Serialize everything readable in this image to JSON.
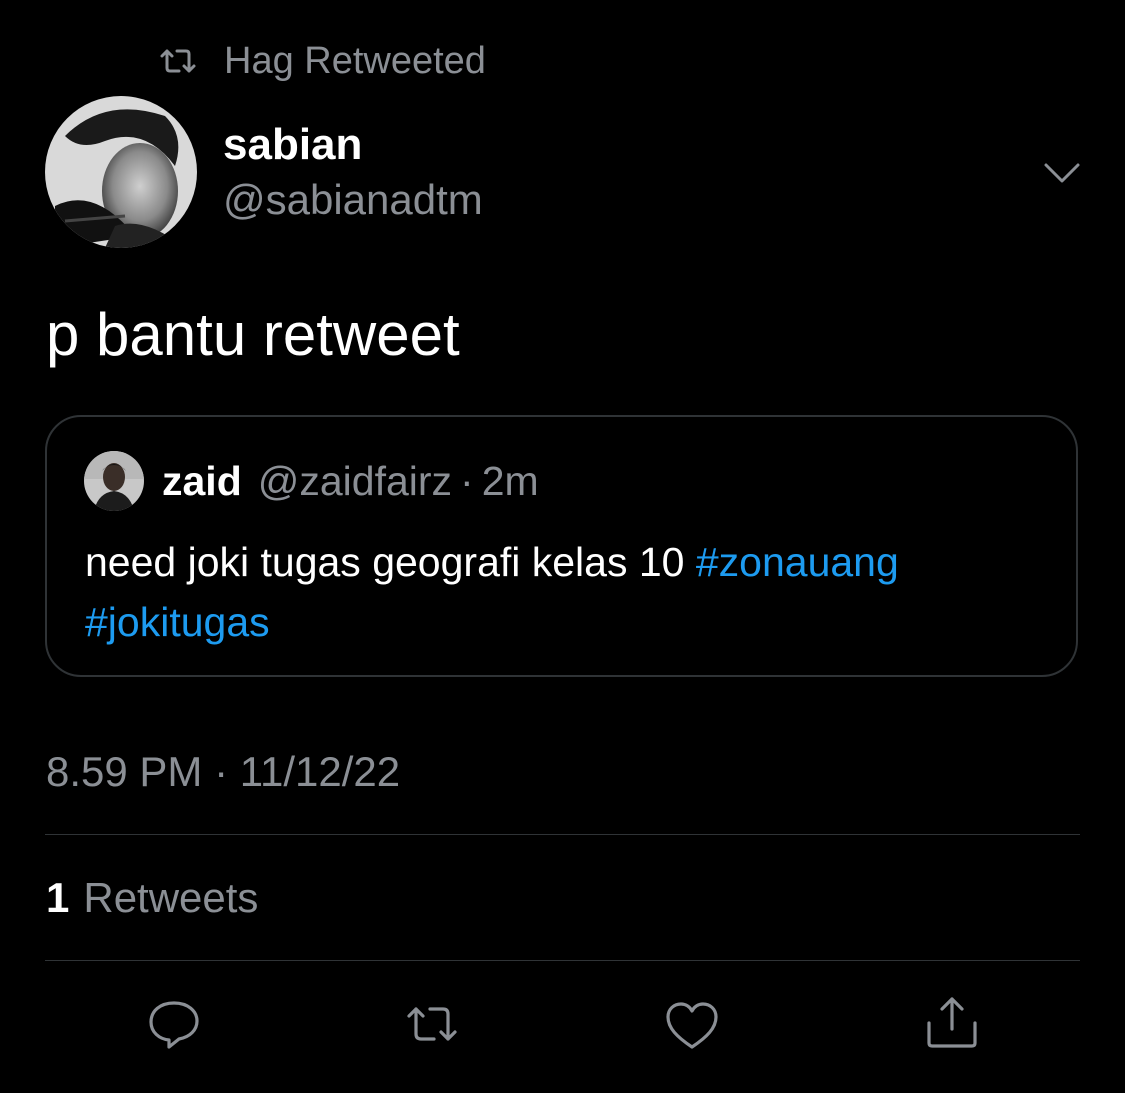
{
  "retweet_context": {
    "text": "Hag Retweeted",
    "icon": "retweet-icon"
  },
  "author": {
    "display_name": "sabian",
    "handle": "@sabianadtm",
    "avatar_icon": "user-avatar"
  },
  "tweet": {
    "text": "p bantu retweet"
  },
  "quoted_tweet": {
    "display_name": "zaid",
    "handle": "@zaidfairz",
    "separator": "·",
    "time": "2m",
    "body_text": "need joki tugas geografi kelas 10 ",
    "hashtag_1": "#zonauang",
    "hashtag_2": "#jokitugas"
  },
  "timestamp": "8.59 PM · 11/12/22",
  "stats": {
    "retweet_count": "1",
    "retweet_label": "Retweets"
  },
  "actions": [
    {
      "name": "reply",
      "icon": "reply-icon"
    },
    {
      "name": "retweet",
      "icon": "retweet-icon"
    },
    {
      "name": "like",
      "icon": "heart-icon"
    },
    {
      "name": "share",
      "icon": "share-icon"
    }
  ],
  "colors": {
    "background": "#000000",
    "text_primary": "#ffffff",
    "text_secondary": "#8b8f95",
    "link": "#1d9bf0",
    "border": "#2f3336"
  }
}
